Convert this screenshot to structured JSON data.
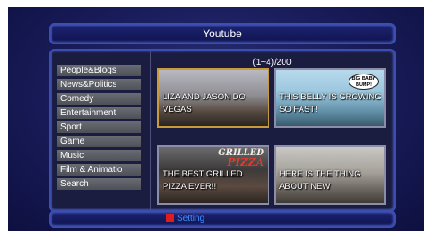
{
  "header": {
    "title": "Youtube"
  },
  "sidebar": {
    "items": [
      {
        "label": "People&Blogs"
      },
      {
        "label": "News&Politics"
      },
      {
        "label": "Comedy"
      },
      {
        "label": "Entertainment"
      },
      {
        "label": "Sport"
      },
      {
        "label": "Game"
      },
      {
        "label": "Music"
      },
      {
        "label": "Film & Animatio"
      },
      {
        "label": "Search"
      }
    ]
  },
  "main": {
    "counter": "(1~4)/200",
    "videos": [
      {
        "caption": "LIZA AND JASON DO VEGAS"
      },
      {
        "caption": "THIS BELLY IS GROWING SO FAST!",
        "bubble": "BIG BABY BUMP!"
      },
      {
        "caption": "THE BEST GRILLED PIZZA EVER!!",
        "logo_top": "GRILLED",
        "logo_bottom": "PIZZA"
      },
      {
        "caption": "HERE IS THE THING ABOUT NEW"
      }
    ]
  },
  "footer": {
    "setting_label": "Setting",
    "key_color": "#e01d1d",
    "key_icon": "red-button-icon"
  }
}
